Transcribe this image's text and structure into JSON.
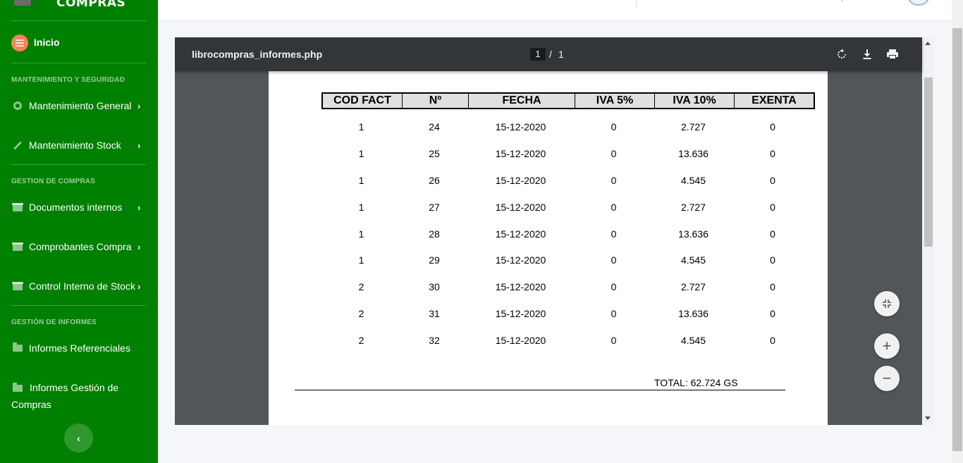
{
  "sidebar": {
    "brand": "COMPRAS",
    "inicio": "Inicio",
    "sections": {
      "mantenimiento": "MANTENIMIENTO Y SEGURIDAD",
      "gestion_compras": "GESTION DE COMPRAS",
      "gestion_informes": "GESTIÓN DE INFORMES"
    },
    "items": {
      "mantenimiento_general": "Mantenimiento General",
      "mantenimiento_stock": "Mantenimiento Stock",
      "documentos_internos": "Documentos internos",
      "comprobantes_compra": "Comprobantes Compra",
      "control_interno_stock": "Control Interno de Stock",
      "informes_referenciales": "Informes Referenciales",
      "informes_gestion_compras": "Informes Gestión de Compras"
    },
    "chevron": "›",
    "collapse_icon": "‹"
  },
  "viewer": {
    "filename": "librocompras_informes.php",
    "current_page": "1",
    "page_separator": "/",
    "total_pages": "1",
    "tools": [
      "rotate-icon",
      "download-icon",
      "print-icon"
    ],
    "zoom_fit": "fit-page-icon",
    "zoom_in": "+",
    "zoom_out": "−"
  },
  "report": {
    "columns": [
      "COD FACT",
      "Nº",
      "FECHA",
      "IVA 5%",
      "IVA 10%",
      "EXENTA"
    ],
    "rows": [
      [
        "1",
        "24",
        "15-12-2020",
        "0",
        "2.727",
        "0"
      ],
      [
        "1",
        "25",
        "15-12-2020",
        "0",
        "13.636",
        "0"
      ],
      [
        "1",
        "26",
        "15-12-2020",
        "0",
        "4.545",
        "0"
      ],
      [
        "1",
        "27",
        "15-12-2020",
        "0",
        "2.727",
        "0"
      ],
      [
        "1",
        "28",
        "15-12-2020",
        "0",
        "13.636",
        "0"
      ],
      [
        "1",
        "29",
        "15-12-2020",
        "0",
        "4.545",
        "0"
      ],
      [
        "2",
        "30",
        "15-12-2020",
        "0",
        "2.727",
        "0"
      ],
      [
        "2",
        "31",
        "15-12-2020",
        "0",
        "13.636",
        "0"
      ],
      [
        "2",
        "32",
        "15-12-2020",
        "0",
        "4.545",
        "0"
      ]
    ],
    "total": "TOTAL: 62.724 GS"
  }
}
